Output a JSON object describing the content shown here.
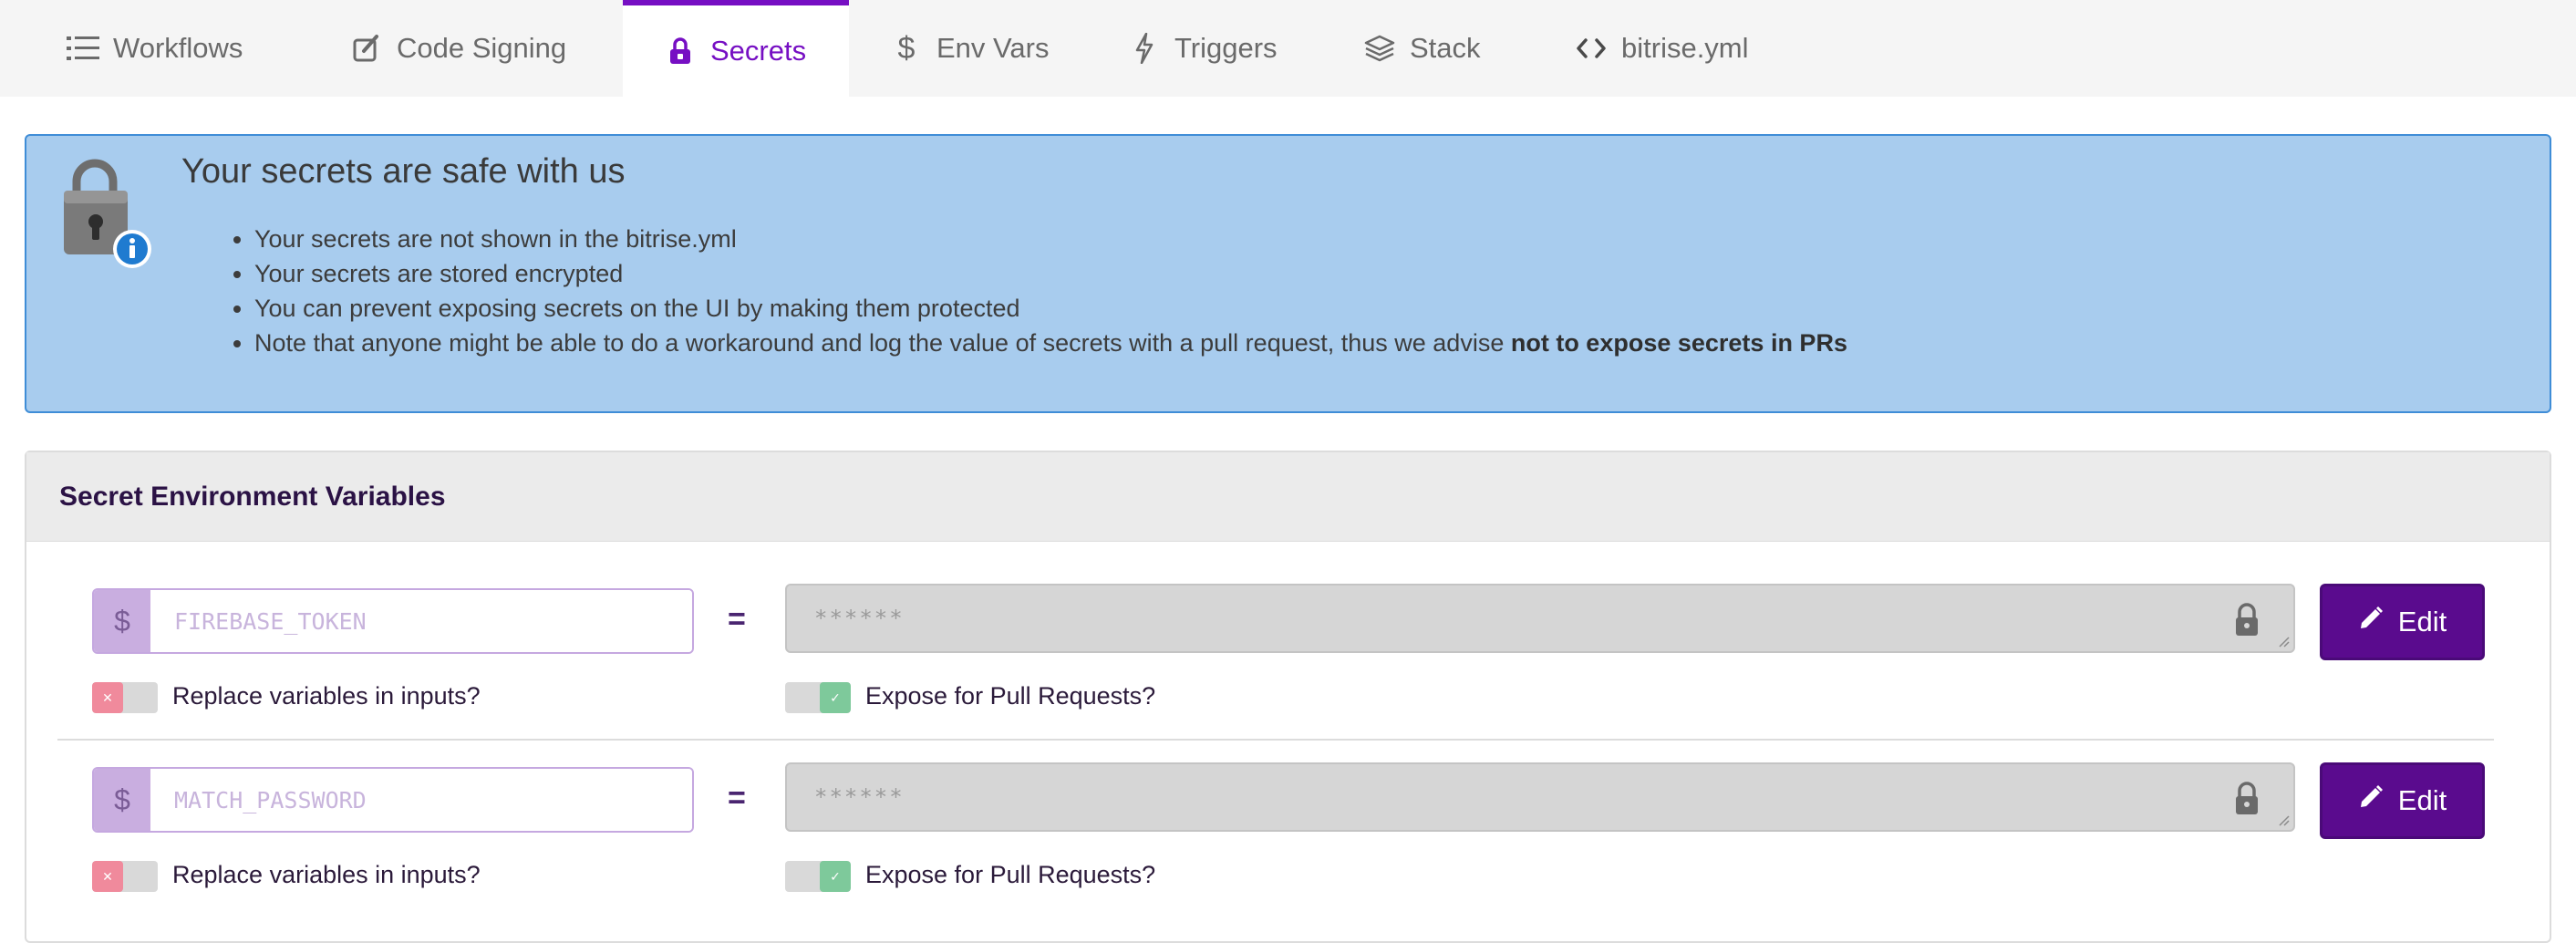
{
  "tabs": [
    {
      "label": "Workflows",
      "icon": "list-icon",
      "active": false
    },
    {
      "label": "Code Signing",
      "icon": "code-signing-icon",
      "active": false
    },
    {
      "label": "Secrets",
      "icon": "lock-icon",
      "active": true
    },
    {
      "label": "Env Vars",
      "icon": "dollar-icon",
      "active": false
    },
    {
      "label": "Triggers",
      "icon": "lightning-icon",
      "active": false
    },
    {
      "label": "Stack",
      "icon": "layers-icon",
      "active": false
    },
    {
      "label": "bitrise.yml",
      "icon": "code-brackets-icon",
      "active": false
    }
  ],
  "banner": {
    "title": "Your secrets are safe with us",
    "bullets": [
      "Your secrets are not shown in the bitrise.yml",
      "Your secrets are stored encrypted",
      "You can prevent exposing secrets on the UI by making them protected"
    ],
    "note_prefix": "Note that anyone might be able to do a workaround and log the value of secrets with a pull request, thus we advise ",
    "note_bold": "not to expose secrets in PRs"
  },
  "panel": {
    "title": "Secret Environment Variables",
    "secrets": [
      {
        "key_placeholder": "FIREBASE_TOKEN",
        "dollar": "$",
        "equals": "=",
        "masked_value": "******",
        "edit_label": "Edit",
        "replace_label": "Replace variables in inputs?",
        "replace_on": false,
        "expose_label": "Expose for Pull Requests?",
        "expose_on": true
      },
      {
        "key_placeholder": "MATCH_PASSWORD",
        "dollar": "$",
        "equals": "=",
        "masked_value": "******",
        "edit_label": "Edit",
        "replace_label": "Replace variables in inputs?",
        "replace_on": false,
        "expose_label": "Expose for Pull Requests?",
        "expose_on": true
      }
    ]
  },
  "colors": {
    "accent": "#760fc3",
    "button": "#5a0b8e",
    "banner_bg": "#a8ccee",
    "banner_border": "#3f8dd7",
    "toggle_off": "#f08a9c",
    "toggle_on": "#7ec99b"
  }
}
